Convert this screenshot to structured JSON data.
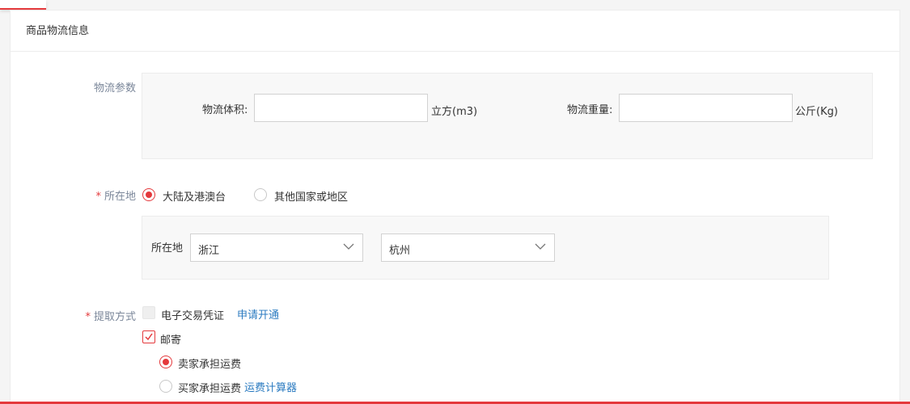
{
  "section": {
    "title": "商品物流信息"
  },
  "logistics_params": {
    "label": "物流参数",
    "volume": {
      "label": "物流体积:",
      "value": "",
      "unit": "立方(m3)"
    },
    "weight": {
      "label": "物流重量:",
      "value": "",
      "unit": "公斤(Kg)"
    }
  },
  "location": {
    "required_mark": "*",
    "label": "所在地",
    "options": [
      {
        "label": "大陆及港澳台",
        "selected": true
      },
      {
        "label": "其他国家或地区",
        "selected": false
      }
    ],
    "inner_label": "所在地",
    "province": "浙江",
    "city": "杭州"
  },
  "pickup": {
    "required_mark": "*",
    "label": "提取方式",
    "e_voucher": {
      "label": "电子交易凭证",
      "checked": false,
      "disabled": true
    },
    "apply_link": "申请开通",
    "mail": {
      "label": "邮寄",
      "checked": true
    },
    "shipping_options": [
      {
        "label": "卖家承担运费",
        "selected": true
      },
      {
        "label": "买家承担运费",
        "selected": false
      }
    ],
    "calculator_link": "运费计算器"
  },
  "colors": {
    "accent": "#e4393c",
    "link": "#2a7ac0",
    "label": "#7a8699"
  }
}
